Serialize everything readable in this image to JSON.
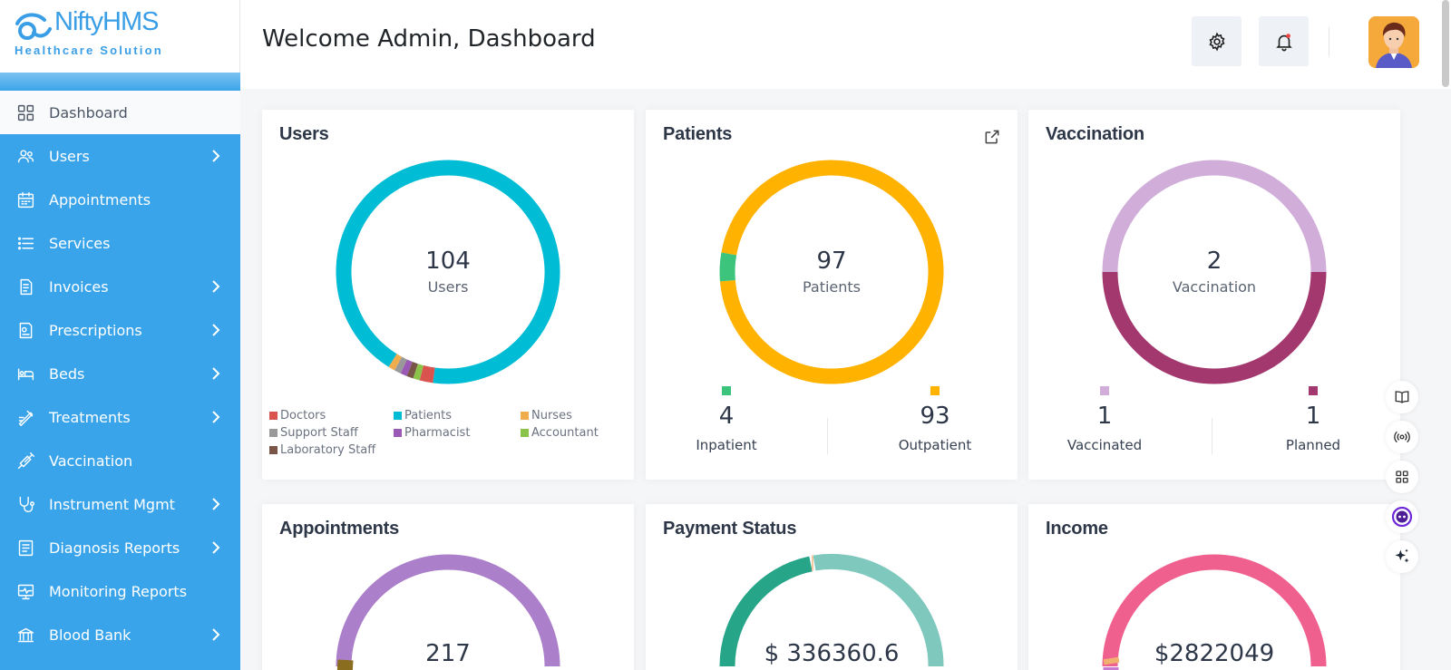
{
  "app": {
    "logo_name": "NiftyHMS",
    "logo_sub": "Healthcare Solution"
  },
  "sidebar": {
    "items": [
      {
        "label": "Dashboard",
        "icon": "grid-icon",
        "has_chevron": false
      },
      {
        "label": "Users",
        "icon": "users-icon",
        "has_chevron": true
      },
      {
        "label": "Appointments",
        "icon": "calendar-icon",
        "has_chevron": false
      },
      {
        "label": "Services",
        "icon": "list-icon",
        "has_chevron": false
      },
      {
        "label": "Invoices",
        "icon": "invoice-icon",
        "has_chevron": true
      },
      {
        "label": "Prescriptions",
        "icon": "prescription-icon",
        "has_chevron": true
      },
      {
        "label": "Beds",
        "icon": "bed-icon",
        "has_chevron": true
      },
      {
        "label": "Treatments",
        "icon": "treatment-icon",
        "has_chevron": true
      },
      {
        "label": "Vaccination",
        "icon": "syringe-icon",
        "has_chevron": false
      },
      {
        "label": "Instrument Mgmt",
        "icon": "stethoscope-icon",
        "has_chevron": true
      },
      {
        "label": "Diagnosis Reports",
        "icon": "report-icon",
        "has_chevron": true
      },
      {
        "label": "Monitoring Reports",
        "icon": "monitor-icon",
        "has_chevron": false
      },
      {
        "label": "Blood Bank",
        "icon": "bank-icon",
        "has_chevron": true
      }
    ]
  },
  "header": {
    "title": "Welcome Admin, Dashboard"
  },
  "cards": {
    "users": {
      "title": "Users",
      "total": "104",
      "total_label": "Users",
      "legend": [
        {
          "label": "Doctors",
          "color": "#d9534f"
        },
        {
          "label": "Patients",
          "color": "#00bcd4"
        },
        {
          "label": "Nurses",
          "color": "#f0ad4e"
        },
        {
          "label": "Support Staff",
          "color": "#999999"
        },
        {
          "label": "Pharmacist",
          "color": "#9b59b6"
        },
        {
          "label": "Accountant",
          "color": "#8bc34a"
        },
        {
          "label": "Laboratory Staff",
          "color": "#795548"
        }
      ]
    },
    "patients": {
      "title": "Patients",
      "total": "97",
      "total_label": "Patients",
      "stats": [
        {
          "value": "4",
          "label": "Inpatient",
          "color": "#3cc47c"
        },
        {
          "value": "93",
          "label": "Outpatient",
          "color": "#ffb300"
        }
      ]
    },
    "vaccination": {
      "title": "Vaccination",
      "total": "2",
      "total_label": "Vaccination",
      "stats": [
        {
          "value": "1",
          "label": "Vaccinated",
          "color": "#d1aed9"
        },
        {
          "value": "1",
          "label": "Planned",
          "color": "#a3386f"
        }
      ]
    },
    "appointments": {
      "title": "Appointments",
      "total": "217"
    },
    "payment": {
      "title": "Payment Status",
      "total": "$ 336360.6"
    },
    "income": {
      "title": "Income",
      "total": "$2822049"
    }
  },
  "chart_data": [
    {
      "type": "pie",
      "title": "Users",
      "categories": [
        "Doctors",
        "Patients",
        "Nurses",
        "Support Staff",
        "Pharmacist",
        "Accountant",
        "Laboratory Staff"
      ],
      "values": [
        2,
        97,
        1,
        1,
        1,
        1,
        1
      ]
    },
    {
      "type": "pie",
      "title": "Patients",
      "categories": [
        "Inpatient",
        "Outpatient"
      ],
      "values": [
        4,
        93
      ]
    },
    {
      "type": "pie",
      "title": "Vaccination",
      "categories": [
        "Vaccinated",
        "Planned"
      ],
      "values": [
        1,
        1
      ]
    }
  ]
}
